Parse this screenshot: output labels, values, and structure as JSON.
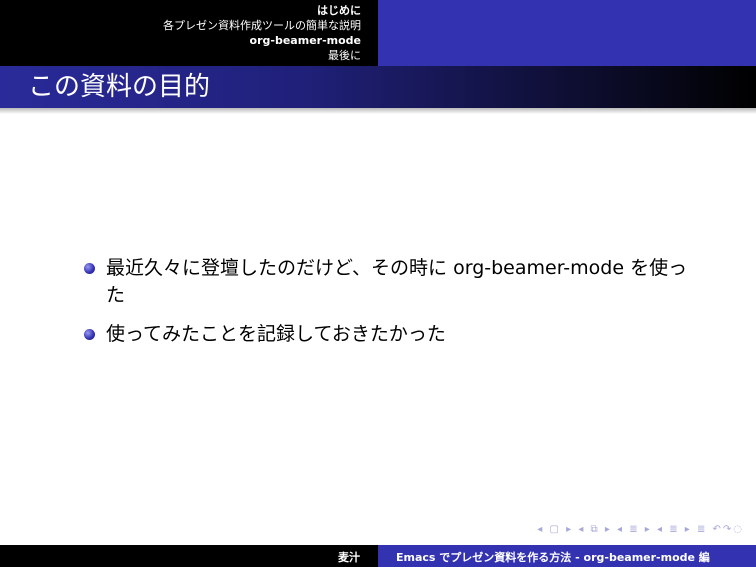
{
  "nav": {
    "sections": [
      {
        "label": "はじめに",
        "current": true
      },
      {
        "label": "各プレゼン資料作成ツールの簡単な説明",
        "current": false
      },
      {
        "label": "org-beamer-mode",
        "current": true
      },
      {
        "label": "最後に",
        "current": false
      }
    ]
  },
  "frame": {
    "title": "この資料の目的",
    "items": [
      "最近久々に登壇したのだけど、その時に org-beamer-mode を使った",
      "使ってみたことを記録しておきたかった"
    ]
  },
  "nav_symbols": "◂ ▢ ▸ ◂ ⧉ ▸ ◂ ≣ ▸ ◂ ≣ ▸  ≣  ↶↷◌",
  "footer": {
    "author": "麦汁",
    "title": "Emacs でプレゼン資料を作る方法 - org-beamer-mode 編"
  },
  "colors": {
    "structure": "#3333b2",
    "black": "#000000",
    "text": "#ffffff"
  }
}
